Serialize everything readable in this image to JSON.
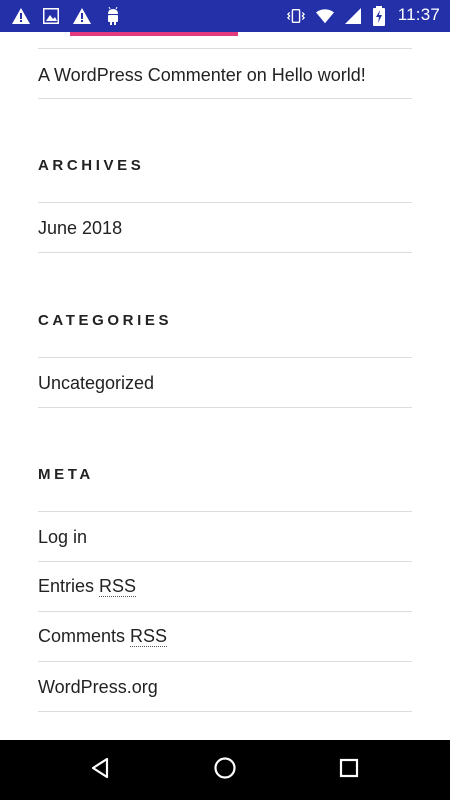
{
  "status_bar": {
    "time": "11:37",
    "icons": [
      "alert-icon",
      "image-icon",
      "alert-icon",
      "android-icon",
      "vibrate-icon",
      "wifi-icon",
      "signal-icon",
      "battery-charging-icon"
    ]
  },
  "recent_comments": {
    "author": "A WordPress Commenter",
    "connector": " on ",
    "post": "Hello world!"
  },
  "archives": {
    "heading": "ARCHIVES",
    "items": [
      "June 2018"
    ]
  },
  "categories": {
    "heading": "CATEGORIES",
    "items": [
      "Uncategorized"
    ]
  },
  "meta": {
    "heading": "META",
    "login": "Log in",
    "entries_prefix": "Entries ",
    "entries_abbr": "RSS",
    "comments_prefix": "Comments ",
    "comments_abbr": "RSS",
    "wordpress": "WordPress.org"
  },
  "colors": {
    "status_bar": "#2330a8",
    "accent": "#e5397d",
    "nav_bar": "#000000"
  }
}
